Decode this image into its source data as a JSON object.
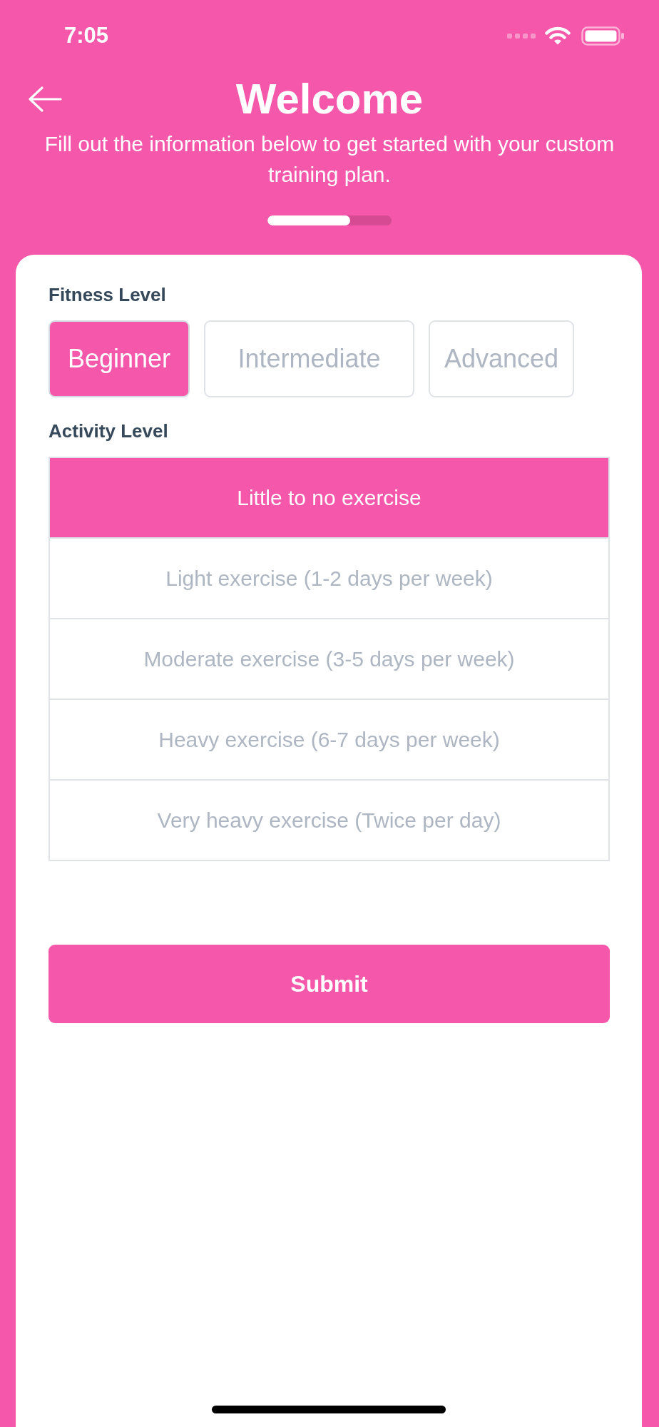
{
  "status_bar": {
    "time": "7:05"
  },
  "header": {
    "title": "Welcome",
    "subtitle": "Fill out the information below to get started with your custom training plan.",
    "progress": {
      "level": 0.667
    }
  },
  "fitness_level": {
    "label": "Fitness Level",
    "options": [
      {
        "label": "Beginner",
        "selected": true
      },
      {
        "label": "Intermediate",
        "selected": false
      },
      {
        "label": "Advanced",
        "selected": false
      }
    ]
  },
  "activity_level": {
    "label": "Activity Level",
    "options": [
      {
        "label": "Little to no exercise",
        "selected": true
      },
      {
        "label": "Light exercise (1-2 days per week)",
        "selected": false
      },
      {
        "label": "Moderate exercise (3-5 days per week)",
        "selected": false
      },
      {
        "label": "Heavy exercise (6-7 days per week)",
        "selected": false
      },
      {
        "label": "Very heavy exercise (Twice per day)",
        "selected": false
      }
    ]
  },
  "submit_button": {
    "label": "Submit"
  }
}
